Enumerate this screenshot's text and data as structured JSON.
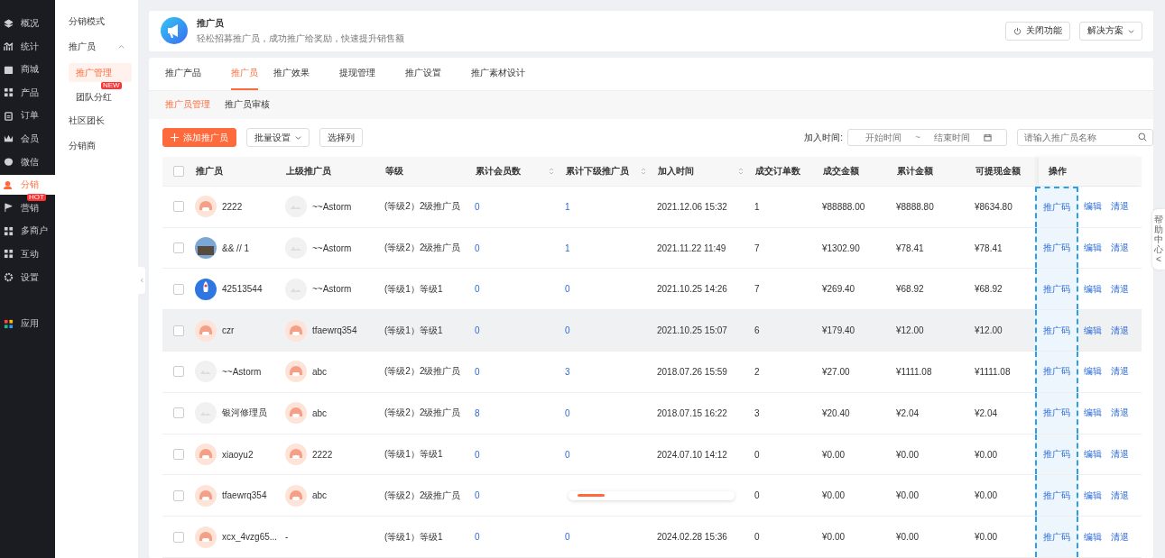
{
  "sidebar": {
    "items": [
      {
        "label": "概况",
        "kind": "layers",
        "selected": false
      },
      {
        "label": "统计",
        "kind": "chart",
        "selected": false
      },
      {
        "label": "商城",
        "kind": "shop",
        "selected": false
      },
      {
        "label": "产品",
        "kind": "grid",
        "selected": false
      },
      {
        "label": "订单",
        "kind": "clipboard",
        "selected": false
      },
      {
        "label": "会员",
        "kind": "crown",
        "selected": false
      },
      {
        "label": "微信",
        "kind": "chat",
        "selected": false
      },
      {
        "label": "分销",
        "kind": "user",
        "selected": true
      },
      {
        "label": "营销",
        "kind": "flag",
        "selected": false,
        "badge": "HOT"
      },
      {
        "label": "多商户",
        "kind": "store",
        "selected": false
      },
      {
        "label": "互动",
        "kind": "grid",
        "selected": false
      },
      {
        "label": "设置",
        "kind": "gear",
        "selected": false
      },
      {
        "label": "应用",
        "kind": "apps",
        "selected": false
      }
    ]
  },
  "submenu": {
    "items": [
      {
        "label": "分销模式",
        "selected": false
      },
      {
        "label": "推广员",
        "selected": false,
        "expanded": true,
        "children": [
          {
            "label": "推广管理",
            "selected": true
          },
          {
            "label": "团队分红",
            "selected": false,
            "badge": "NEW"
          }
        ]
      },
      {
        "label": "社区团长",
        "selected": false
      },
      {
        "label": "分销商",
        "selected": false
      }
    ]
  },
  "header": {
    "title": "推广员",
    "subtitle": "轻松招募推广员，成功推广给奖励，快速提升销售额",
    "close_button": "关闭功能",
    "solutions_button": "解决方案"
  },
  "tabs": [
    {
      "label": "推广产品",
      "selected": false
    },
    {
      "label": "推广员",
      "selected": true
    },
    {
      "label": "推广效果",
      "selected": false
    },
    {
      "label": "提现管理",
      "selected": false
    },
    {
      "label": "推广设置",
      "selected": false
    },
    {
      "label": "推广素材设计",
      "selected": false
    }
  ],
  "subtabs": [
    {
      "label": "推广员管理",
      "selected": true
    },
    {
      "label": "推广员审核",
      "selected": false
    }
  ],
  "toolbar": {
    "add_button": "添加推广员",
    "batch_button": "批量设置",
    "columns_button": "选择列",
    "date_label": "加入时间:",
    "date_start_placeholder": "开始时间",
    "date_separator": "~",
    "date_end_placeholder": "结束时间",
    "search_placeholder": "请输入推广员名称"
  },
  "table": {
    "all_checked": false,
    "columns": [
      {
        "label": "推广员",
        "sortable": false
      },
      {
        "label": "上级推广员",
        "sortable": false
      },
      {
        "label": "等级",
        "sortable": false
      },
      {
        "label": "累计会员数",
        "sortable": true
      },
      {
        "label": "累计下级推广员",
        "sortable": true
      },
      {
        "label": "加入时间",
        "sortable": true
      },
      {
        "label": "成交订单数",
        "sortable": false
      },
      {
        "label": "成交金额",
        "sortable": false
      },
      {
        "label": "累计金额",
        "sortable": false
      },
      {
        "label": "可提现金额",
        "sortable": false
      },
      {
        "label": "操作",
        "sortable": false
      }
    ],
    "rows": [
      {
        "checked": false,
        "hovered": false,
        "avatar": {
          "kind": "cartoon"
        },
        "name": "2222",
        "parent_avatar": {
          "kind": "blank"
        },
        "parent": "~~Astorm",
        "level": "(等级2）2级推广员",
        "members": "0",
        "subordinates": "1",
        "joined": "2021.12.06 15:32",
        "orders": "1",
        "sales": "¥88888.00",
        "total": "¥8888.80",
        "withdrawable": "¥8634.80",
        "actions": [
          "推广码",
          "编辑",
          "清退"
        ]
      },
      {
        "checked": false,
        "hovered": false,
        "avatar": {
          "kind": "photo"
        },
        "name": "&& // 1",
        "parent_avatar": {
          "kind": "blank"
        },
        "parent": "~~Astorm",
        "level": "(等级2）2级推广员",
        "members": "0",
        "subordinates": "1",
        "joined": "2021.11.22 11:49",
        "orders": "7",
        "sales": "¥1302.90",
        "total": "¥78.41",
        "withdrawable": "¥78.41",
        "actions": [
          "推广码",
          "编辑",
          "清退"
        ]
      },
      {
        "checked": false,
        "hovered": false,
        "avatar": {
          "kind": "rocket"
        },
        "name": "42513544",
        "parent_avatar": {
          "kind": "blank"
        },
        "parent": "~~Astorm",
        "level": "(等级1）等级1",
        "members": "0",
        "subordinates": "0",
        "joined": "2021.10.25 14:26",
        "orders": "7",
        "sales": "¥269.40",
        "total": "¥68.92",
        "withdrawable": "¥68.92",
        "actions": [
          "推广码",
          "编辑",
          "清退"
        ]
      },
      {
        "checked": false,
        "hovered": true,
        "avatar": {
          "kind": "cartoon"
        },
        "name": "czr",
        "parent_avatar": {
          "kind": "cartoon"
        },
        "parent": "tfaewrq354",
        "level": "(等级1）等级1",
        "members": "0",
        "subordinates": "0",
        "joined": "2021.10.25 15:07",
        "orders": "6",
        "sales": "¥179.40",
        "total": "¥12.00",
        "withdrawable": "¥12.00",
        "actions": [
          "推广码",
          "编辑",
          "清退"
        ]
      },
      {
        "checked": false,
        "hovered": false,
        "avatar": {
          "kind": "blank"
        },
        "name": "~~Astorm",
        "parent_avatar": {
          "kind": "cartoon"
        },
        "parent": "abc",
        "level": "(等级2）2级推广员",
        "members": "0",
        "subordinates": "3",
        "joined": "2018.07.26 15:59",
        "orders": "2",
        "sales": "¥27.00",
        "total": "¥1111.08",
        "withdrawable": "¥1111.08",
        "actions": [
          "推广码",
          "编辑",
          "清退"
        ]
      },
      {
        "checked": false,
        "hovered": false,
        "avatar": {
          "kind": "blank"
        },
        "name": "银河修理员",
        "parent_avatar": {
          "kind": "cartoon"
        },
        "parent": "abc",
        "level": "(等级2）2级推广员",
        "members": "8",
        "subordinates": "0",
        "joined": "2018.07.15 16:22",
        "orders": "3",
        "sales": "¥20.40",
        "total": "¥2.04",
        "withdrawable": "¥2.04",
        "actions": [
          "推广码",
          "编辑",
          "清退"
        ]
      },
      {
        "checked": false,
        "hovered": false,
        "avatar": {
          "kind": "cartoon"
        },
        "name": "xiaoyu2",
        "parent_avatar": {
          "kind": "cartoon"
        },
        "parent": "2222",
        "level": "(等级1）等级1",
        "members": "0",
        "subordinates": "0",
        "joined": "2024.07.10 14:12",
        "orders": "0",
        "sales": "¥0.00",
        "total": "¥0.00",
        "withdrawable": "¥0.00",
        "actions": [
          "推广码",
          "编辑",
          "清退"
        ]
      },
      {
        "checked": false,
        "hovered": false,
        "avatar": {
          "kind": "cartoon"
        },
        "name": "tfaewrq354",
        "parent_avatar": {
          "kind": "cartoon"
        },
        "parent": "abc",
        "level": "(等级2）2级推广员",
        "members": "0",
        "orders": "0",
        "sales": "¥0.00",
        "total": "¥0.00",
        "withdrawable": "¥0.00",
        "actions": [
          "推广码",
          "编辑",
          "清退"
        ],
        "scroller": true
      },
      {
        "checked": false,
        "hovered": false,
        "avatar": {
          "kind": "cartoon"
        },
        "name": "xcx_4vzg65...",
        "parent": "-",
        "level": "(等级1）等级1",
        "members": "0",
        "subordinates": "0",
        "joined": "2024.02.28 15:36",
        "orders": "0",
        "sales": "¥0.00",
        "total": "¥0.00",
        "withdrawable": "¥0.00",
        "actions": [
          "推广码",
          "编辑",
          "清退"
        ]
      }
    ]
  },
  "help_tab": {
    "label": "帮助中心",
    "arrow": "<"
  }
}
